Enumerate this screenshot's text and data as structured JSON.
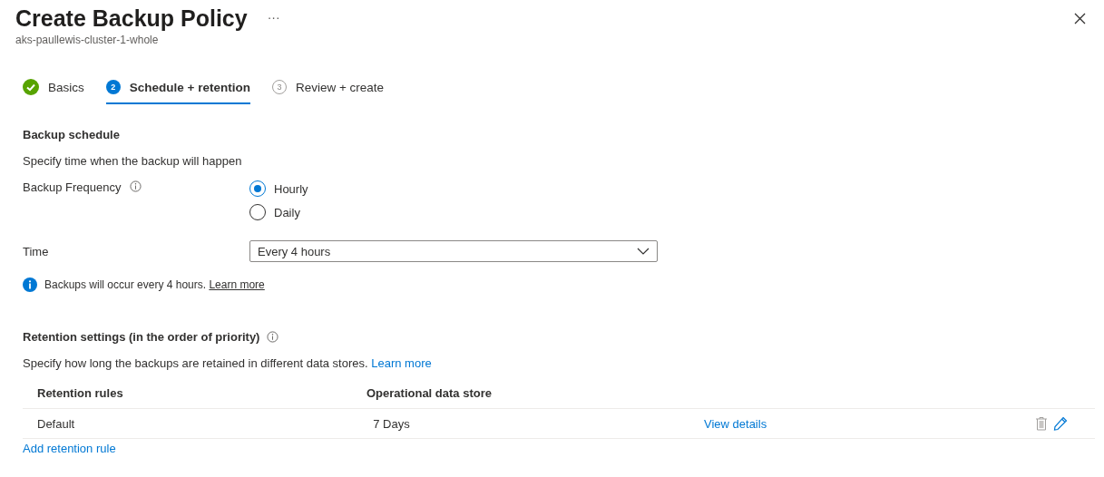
{
  "header": {
    "title": "Create Backup Policy",
    "more": "···",
    "subtitle": "aks-paullewis-cluster-1-whole"
  },
  "steps": [
    {
      "label": "Basics",
      "completed": true,
      "selected": false
    },
    {
      "number": "2",
      "label": "Schedule + retention",
      "completed": false,
      "selected": true
    },
    {
      "number": "3",
      "label": "Review + create",
      "completed": false,
      "selected": false
    }
  ],
  "schedule": {
    "heading": "Backup schedule",
    "description": "Specify time when the backup will happen",
    "frequency": {
      "label": "Backup Frequency",
      "options": [
        {
          "label": "Hourly",
          "selected": true
        },
        {
          "label": "Daily",
          "selected": false
        }
      ]
    },
    "time": {
      "label": "Time",
      "value": "Every 4 hours"
    },
    "info": {
      "text": "Backups will occur every 4 hours.",
      "link": "Learn more"
    }
  },
  "retention": {
    "heading": "Retention settings (in the order of priority)",
    "description": "Specify how long the backups are retained in different data stores.",
    "link": "Learn more",
    "table": {
      "columns": [
        "Retention rules",
        "Operational data store"
      ],
      "rows": [
        {
          "rule": "Default",
          "store": "7 Days",
          "details": "View details",
          "delete_disabled": true
        }
      ]
    },
    "add_link": "Add retention rule"
  }
}
